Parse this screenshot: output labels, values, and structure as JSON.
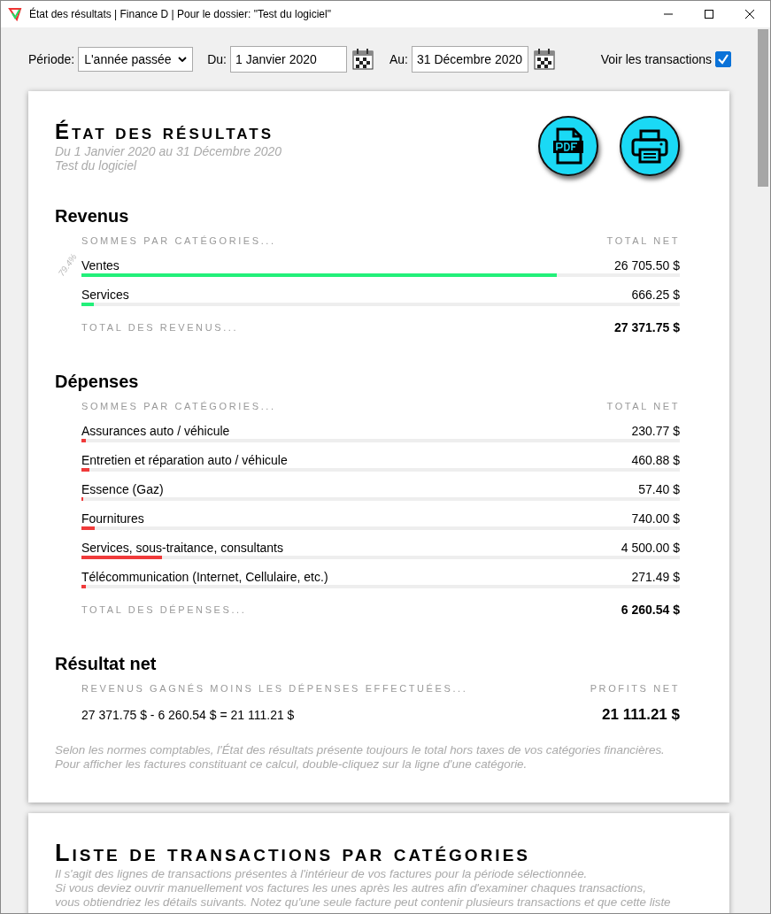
{
  "window": {
    "title": "État des résultats | Finance D | Pour le dossier: \"Test du logiciel\""
  },
  "toolbar": {
    "period_label": "Période:",
    "period_value": "L'année passée",
    "from_label": "Du:",
    "from_value": "1 Janvier 2020",
    "to_label": "Au:",
    "to_value": "31 Décembre 2020",
    "show_label": "Voir les transactions",
    "show_checked": true
  },
  "report": {
    "title": "État des résultats",
    "subtitle": "Du 1 Janvier 2020 au 31 Décembre 2020",
    "file": "Test du logiciel",
    "sections": [
      {
        "heading": "Revenus",
        "col_left": "SOMMES PAR CATÉGORIES...",
        "col_right": "TOTAL NET",
        "color": "#22f07a",
        "rows": [
          {
            "label": "Ventes",
            "amount": "26 705.50 $",
            "level": 0.794,
            "percent": "79.4%"
          },
          {
            "label": "Services",
            "amount": "666.25 $",
            "level": 0.02
          }
        ],
        "total_label": "TOTAL DES REVENUS...",
        "total": "27 371.75 $"
      },
      {
        "heading": "Dépenses",
        "col_left": "SOMMES PAR CATÉGORIES...",
        "col_right": "TOTAL NET",
        "color": "#f03a3a",
        "rows": [
          {
            "label": "Assurances auto / véhicule",
            "amount": "230.77 $",
            "level": 0.007
          },
          {
            "label": "Entretien et réparation auto / véhicule",
            "amount": "460.88 $",
            "level": 0.014
          },
          {
            "label": "Essence (Gaz)",
            "amount": "57.40 $",
            "level": 0.003
          },
          {
            "label": "Fournitures",
            "amount": "740.00 $",
            "level": 0.022
          },
          {
            "label": "Services, sous-traitance, consultants",
            "amount": "4 500.00 $",
            "level": 0.135
          },
          {
            "label": "Télécommunication (Internet, Cellulaire, etc.)",
            "amount": "271.49 $",
            "level": 0.008
          }
        ],
        "total_label": "TOTAL DES DÉPENSES...",
        "total": "6 260.54 $"
      }
    ],
    "net": {
      "heading": "Résultat net",
      "col_left": "REVENUS GAGNÉS MOINS LES DÉPENSES EFFECTUÉES...",
      "col_right": "PROFITS NET",
      "formula": "27 371.75 $ - 6 260.54 $ = 21 111.21 $",
      "value": "21 111.21 $"
    },
    "notes": [
      "Selon les normes comptables, l'État des résultats présente toujours le total hors taxes de vos catégories financières.",
      "Pour afficher les factures constituant ce calcul, double-cliquez sur la ligne d'une catégorie."
    ]
  },
  "transactions": {
    "title": "Liste de transactions par catégories",
    "lines": [
      "Il s'agit des lignes de transactions présentes à l'intérieur de vos factures pour la période sélectionnée.",
      "Si vous deviez ouvrir manuellement vos factures les unes après les autres afin d'examiner chaques transactions,",
      "vous obtiendriez les détails suivants. Notez qu'une seule facture peut contenir plusieurs transactions et que cette liste"
    ]
  }
}
